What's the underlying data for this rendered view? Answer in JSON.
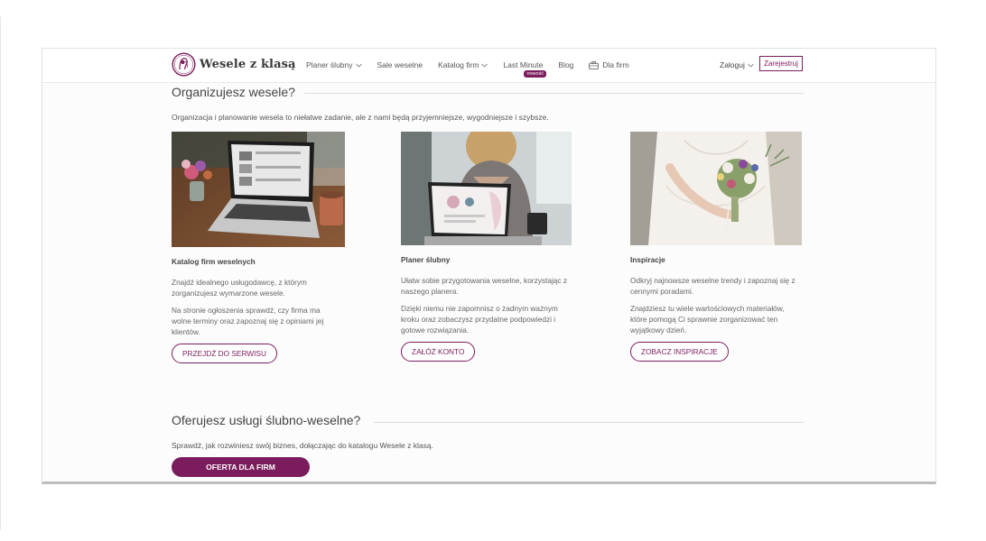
{
  "header": {
    "logo_text": "Wesele z klasą",
    "nav": [
      {
        "label": "Planer ślubny",
        "has_dropdown": true
      },
      {
        "label": "Sale weselne",
        "has_dropdown": false
      },
      {
        "label": "Katalog firm",
        "has_dropdown": true
      },
      {
        "label": "Last Minute",
        "has_dropdown": false,
        "badge": "nowość"
      },
      {
        "label": "Blog",
        "has_dropdown": false
      },
      {
        "label": "Dla firm",
        "has_dropdown": false,
        "icon": "briefcase-icon"
      }
    ],
    "login_label": "Zaloguj",
    "register_label": "Zarejestruj"
  },
  "organize": {
    "title": "Organizujesz wesele?",
    "intro": "Organizacja i planowanie wesela to niełatwe zadanie, ale z nami będą przyjemniejsze, wygodniejsze i szybsze.",
    "cards": [
      {
        "title": "Katalog firm weselnych",
        "p1": "Znajdź idealnego usługodawcę, z którym zorganizujesz wymarzone wesele.",
        "p2": "Na stronie ogłoszenia sprawdź, czy firma ma wolne terminy oraz zapoznaj się z opiniami jej klientów.",
        "button": "PRZEJDŹ DO SERWISU"
      },
      {
        "title": "Planer ślubny",
        "p1": "Ułatw sobie przygotowania weselne, korzystając z naszego planera.",
        "p2": "Dzięki niemu nie zapomnisz o żadnym ważnym kroku oraz zobaczysz przydatne podpowiedzi i gotowe rozwiązania.",
        "button": "ZAŁÓŻ KONTO"
      },
      {
        "title": "Inspiracje",
        "p1": "Odkryj najnowsze weselne trendy i zapoznaj się z cennymi poradami.",
        "p2": "Znajdziesz tu wiele wartościowych materiałów, które pomogą Ci sprawnie zorganizować ten wyjątkowy dzień.",
        "button": "ZOBACZ INSPIRACJE"
      }
    ]
  },
  "business": {
    "title": "Oferujesz usługi ślubno-weselne?",
    "intro": "Sprawdź, jak rozwiniesz swój biznes, dołączając do katalogu Wesele z klasą.",
    "button": "OFERTA DLA FIRM"
  },
  "colors": {
    "accent": "#7b1c5c",
    "text": "#444444"
  }
}
